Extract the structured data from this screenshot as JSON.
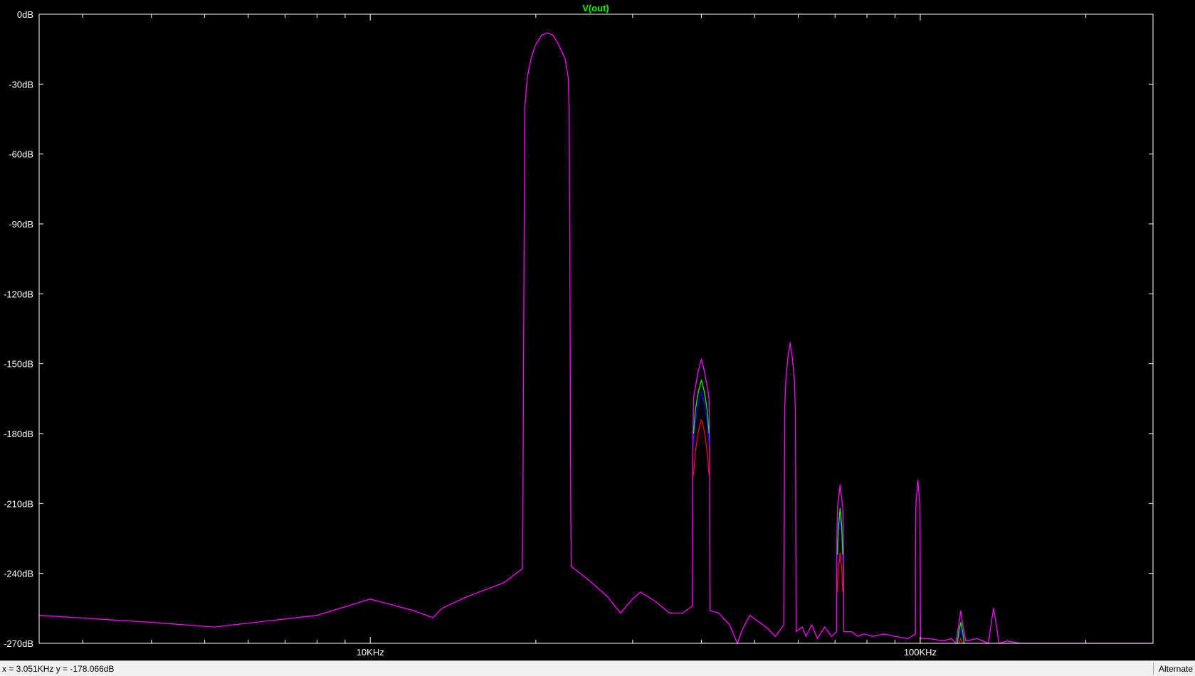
{
  "chart_data": {
    "type": "line",
    "title": "V(out)",
    "title_color": "#00ff00",
    "x_scale": "log",
    "xlim": [
      2500,
      265000
    ],
    "ylim": [
      -270,
      0
    ],
    "ylabel_unit": "dB",
    "y_ticks": [
      "0dB",
      "-30dB",
      "-60dB",
      "-90dB",
      "-120dB",
      "-150dB",
      "-180dB",
      "-210dB",
      "-240dB",
      "-270dB"
    ],
    "y_tick_values": [
      0,
      -30,
      -60,
      -90,
      -120,
      -150,
      -180,
      -210,
      -240,
      -270
    ],
    "x_ticks": [
      "10KHz",
      "100KHz"
    ],
    "x_tick_values": [
      10000,
      100000
    ],
    "x_minor_ticks": [
      3000,
      4000,
      5000,
      6000,
      7000,
      8000,
      9000,
      20000,
      30000,
      40000,
      50000,
      60000,
      70000,
      80000,
      90000,
      200000
    ],
    "colors": {
      "background": "#000000",
      "frame": "#ffffff",
      "text": "#ffffff",
      "magenta": "#ff00ff",
      "green": "#00ff00",
      "blue": "#0000ff",
      "red": "#ff0000"
    },
    "series": [
      {
        "color": "#ff00ff",
        "points": [
          [
            2500,
            -258
          ],
          [
            4000,
            -261
          ],
          [
            5200,
            -263
          ],
          [
            8000,
            -258
          ],
          [
            10000,
            -251
          ],
          [
            12000,
            -256
          ],
          [
            13000,
            -259
          ],
          [
            13500,
            -255
          ],
          [
            15000,
            -250
          ],
          [
            17500,
            -244
          ],
          [
            18900,
            -238
          ],
          [
            18950,
            -210
          ],
          [
            19000,
            -150
          ],
          [
            19050,
            -90
          ],
          [
            19100,
            -40
          ],
          [
            19300,
            -27
          ],
          [
            19600,
            -19
          ],
          [
            20000,
            -13
          ],
          [
            20500,
            -9
          ],
          [
            21000,
            -8
          ],
          [
            21500,
            -9
          ],
          [
            22000,
            -13
          ],
          [
            22600,
            -19
          ],
          [
            22900,
            -27
          ],
          [
            23000,
            -40
          ],
          [
            23050,
            -90
          ],
          [
            23100,
            -150
          ],
          [
            23150,
            -210
          ],
          [
            23200,
            -237
          ],
          [
            25000,
            -243
          ],
          [
            27000,
            -250
          ],
          [
            28500,
            -257
          ],
          [
            30000,
            -251
          ],
          [
            31000,
            -248
          ],
          [
            33000,
            -252
          ],
          [
            35000,
            -257
          ],
          [
            37000,
            -257
          ],
          [
            38500,
            -254
          ],
          [
            38550,
            -230
          ],
          [
            38600,
            -190
          ],
          [
            38700,
            -165
          ],
          [
            39000,
            -160
          ],
          [
            39500,
            -153
          ],
          [
            40000,
            -148
          ],
          [
            40500,
            -153
          ],
          [
            41000,
            -160
          ],
          [
            41300,
            -165
          ],
          [
            41400,
            -190
          ],
          [
            41450,
            -230
          ],
          [
            41500,
            -256
          ],
          [
            43000,
            -257
          ],
          [
            45000,
            -262
          ],
          [
            46500,
            -272
          ],
          [
            47500,
            -264
          ],
          [
            49000,
            -258
          ],
          [
            51000,
            -261
          ],
          [
            53000,
            -264
          ],
          [
            54500,
            -267
          ],
          [
            56500,
            -262
          ],
          [
            56600,
            -220
          ],
          [
            56700,
            -170
          ],
          [
            57000,
            -156
          ],
          [
            57500,
            -147
          ],
          [
            58000,
            -141
          ],
          [
            58500,
            -147
          ],
          [
            59000,
            -156
          ],
          [
            59300,
            -170
          ],
          [
            59400,
            -220
          ],
          [
            59500,
            -265
          ],
          [
            61000,
            -263
          ],
          [
            62000,
            -267
          ],
          [
            63500,
            -262
          ],
          [
            65000,
            -268
          ],
          [
            67000,
            -263
          ],
          [
            69000,
            -267
          ],
          [
            70500,
            -265
          ],
          [
            70550,
            -225
          ],
          [
            70700,
            -212
          ],
          [
            71500,
            -202
          ],
          [
            72300,
            -212
          ],
          [
            72500,
            -225
          ],
          [
            72600,
            -265
          ],
          [
            75000,
            -265
          ],
          [
            77000,
            -267
          ],
          [
            79000,
            -266
          ],
          [
            82000,
            -267
          ],
          [
            86000,
            -266
          ],
          [
            90000,
            -267
          ],
          [
            95000,
            -268
          ],
          [
            98000,
            -266
          ],
          [
            98050,
            -225
          ],
          [
            98200,
            -210
          ],
          [
            99000,
            -200
          ],
          [
            99800,
            -210
          ],
          [
            99950,
            -225
          ],
          [
            100100,
            -268
          ],
          [
            104000,
            -268
          ],
          [
            110000,
            -269
          ],
          [
            114000,
            -268
          ],
          [
            116000,
            -270
          ],
          [
            117500,
            -262
          ],
          [
            118500,
            -256
          ],
          [
            119500,
            -262
          ],
          [
            121000,
            -269
          ],
          [
            127000,
            -268
          ],
          [
            133000,
            -270
          ],
          [
            134500,
            -262
          ],
          [
            136000,
            -255
          ],
          [
            137500,
            -262
          ],
          [
            139000,
            -270
          ],
          [
            144000,
            -269
          ],
          [
            152000,
            -271
          ],
          [
            162000,
            -270
          ],
          [
            175000,
            -272
          ],
          [
            190000,
            -271
          ],
          [
            205000,
            -273
          ],
          [
            220000,
            -272
          ],
          [
            240000,
            -274
          ],
          [
            265000,
            -274
          ]
        ]
      },
      {
        "color": "#00ff00",
        "points": [
          [
            38700,
            -180
          ],
          [
            39000,
            -170
          ],
          [
            39500,
            -162
          ],
          [
            40000,
            -157
          ],
          [
            40500,
            -162
          ],
          [
            41000,
            -170
          ],
          [
            41300,
            -180
          ],
          [
            70700,
            -232
          ],
          [
            71000,
            -220
          ],
          [
            71500,
            -212
          ],
          [
            72000,
            -220
          ],
          [
            72300,
            -232
          ],
          [
            116800,
            -270
          ],
          [
            117500,
            -265
          ],
          [
            118500,
            -261
          ],
          [
            119500,
            -265
          ],
          [
            120200,
            -270
          ]
        ]
      },
      {
        "color": "#0000ff",
        "points": [
          [
            38700,
            -185
          ],
          [
            39000,
            -175
          ],
          [
            39500,
            -167
          ],
          [
            40000,
            -162
          ],
          [
            40500,
            -167
          ],
          [
            41000,
            -175
          ],
          [
            41300,
            -185
          ],
          [
            70700,
            -235
          ],
          [
            71000,
            -223
          ],
          [
            71500,
            -216
          ],
          [
            72000,
            -223
          ],
          [
            72300,
            -235
          ],
          [
            116800,
            -270
          ],
          [
            117500,
            -267
          ],
          [
            118500,
            -264
          ],
          [
            119500,
            -267
          ],
          [
            120200,
            -270
          ]
        ]
      },
      {
        "color": "#ff0000",
        "points": [
          [
            38700,
            -198
          ],
          [
            39000,
            -188
          ],
          [
            39500,
            -179
          ],
          [
            40000,
            -174
          ],
          [
            40500,
            -179
          ],
          [
            41000,
            -188
          ],
          [
            41300,
            -198
          ],
          [
            70700,
            -248
          ],
          [
            71000,
            -238
          ],
          [
            71500,
            -231
          ],
          [
            72000,
            -238
          ],
          [
            72300,
            -248
          ],
          [
            116800,
            -271
          ],
          [
            117500,
            -270
          ],
          [
            118500,
            -268
          ],
          [
            119500,
            -270
          ],
          [
            120200,
            -271
          ]
        ]
      }
    ]
  },
  "status": {
    "cursor_readout": "x = 3.051KHz    y = -178.066dB",
    "mode": "Alternate"
  }
}
